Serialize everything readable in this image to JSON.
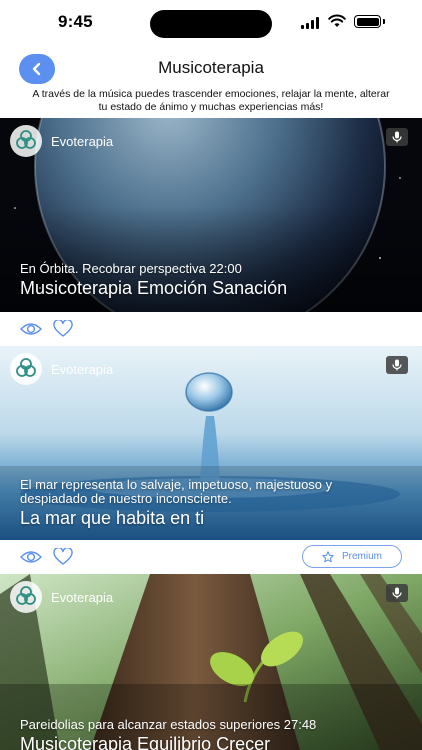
{
  "status_bar": {
    "time": "9:45"
  },
  "header": {
    "title": "Musicoterapia",
    "subtitle": "A través de la música puedes trascender emociones, relajar la mente, alterar tu estado de ánimo y muchas experiencias más!"
  },
  "cards": [
    {
      "brand": "Evoterapia",
      "description": "En Órbita. Recobrar perspectiva 22:00",
      "title": "Musicoterapia Emoción Sanación",
      "image": "planet-in-space",
      "premium": false
    },
    {
      "brand": "Evoterapia",
      "description": "El mar representa lo salvaje, impetuoso, majestuoso y despiadado de nuestro inconsciente.",
      "title": "La mar que habita en ti",
      "image": "water-drop",
      "premium": true,
      "premium_label": "Premium"
    },
    {
      "brand": "Evoterapia",
      "description": "Pareidolias para alcanzar estados superiores 27:48",
      "title": "Musicoterapia Equilibrio Crecer",
      "image": "tree-sprout",
      "premium": false
    }
  ],
  "icons": {
    "back": "chevron-left-icon",
    "brand": "triskelion-logo-icon",
    "mic": "microphone-icon",
    "view": "eye-icon",
    "like": "heart-icon",
    "premium": "star-icon"
  },
  "colors": {
    "accent": "#5b8ff0",
    "outline": "#7aa2f0"
  }
}
